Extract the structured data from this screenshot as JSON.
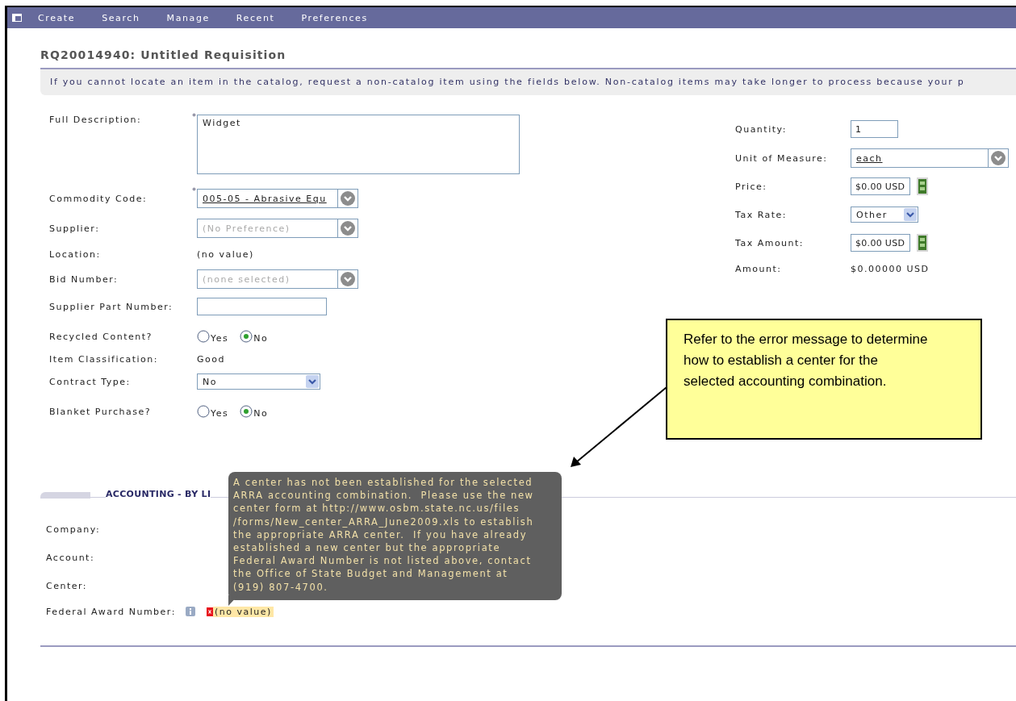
{
  "nav": {
    "items": [
      "Create",
      "Search",
      "Manage",
      "Recent",
      "Preferences"
    ]
  },
  "title": "RQ20014940: Untitled Requisition",
  "banner": "If you cannot locate an item in the catalog, request a non-catalog item using the fields below. Non-catalog items may take longer to process because your p",
  "item_fields": [
    {
      "kind": "textarea",
      "label": "Full Description:",
      "value": "Widget",
      "required": true
    },
    {
      "kind": "combo",
      "label": "Commodity Code:",
      "value": "005-05 - Abrasive Equ",
      "required": true
    },
    {
      "kind": "combo",
      "label": "Supplier:",
      "placeholder": "(No Preference)",
      "required": false
    },
    {
      "kind": "text",
      "label": "Location:",
      "value": "(no value)",
      "required": false
    },
    {
      "kind": "combo",
      "label": "Bid Number:",
      "placeholder": "(none selected)",
      "required": false
    },
    {
      "kind": "input",
      "label": "Supplier Part Number:",
      "required": false
    },
    {
      "kind": "radio",
      "label": "Recycled Content?",
      "options": [
        {
          "label": "Yes",
          "selected": false
        },
        {
          "label": "No",
          "selected": true
        }
      ],
      "required": false
    },
    {
      "kind": "text",
      "label": "Item Classification:",
      "value": "Good",
      "required": false
    },
    {
      "kind": "select",
      "label": "Contract Type:",
      "value": "No",
      "required": false
    },
    {
      "kind": "radio",
      "label": "Blanket Purchase?",
      "options": [
        {
          "label": "Yes",
          "selected": false
        },
        {
          "label": "No",
          "selected": true
        }
      ],
      "required": false
    }
  ],
  "price_fields": [
    {
      "kind": "input",
      "label": "Quantity:",
      "value": "1"
    },
    {
      "kind": "combo",
      "label": "Unit of Measure:",
      "value": "each"
    },
    {
      "kind": "calc",
      "label": "Price:",
      "value": "$0.00 USD"
    },
    {
      "kind": "select",
      "label": "Tax Rate:",
      "value": "Other"
    },
    {
      "kind": "calc",
      "label": "Tax Amount:",
      "value": "$0.00 USD"
    },
    {
      "kind": "text",
      "label": "Amount:",
      "value": "$0.00000 USD"
    }
  ],
  "callout": "Refer to the error message to determine how to establish a center for the selected accounting combination.",
  "accounting": {
    "heading": "ACCOUNTING - BY LI",
    "fields": [
      {
        "label": "Company:"
      },
      {
        "label": "Account:"
      },
      {
        "label": "Center:"
      },
      {
        "label": "Federal Award Number:",
        "value": "(no value)",
        "error": true
      }
    ]
  },
  "error_tooltip": {
    "lines": [
      "A center has not been established for the selected",
      "ARRA accounting combination.  Please use the new",
      "center form at http://www.osbm.state.nc.us/files",
      "/forms/New_center_ARRA_June2009.xls to establish",
      "the appropriate ARRA center.  If you have already",
      "established a new center but the appropriate",
      "Federal Award Number is not listed above, contact",
      "the Office of State Budget and Management at",
      "(919) 807-4700."
    ]
  }
}
